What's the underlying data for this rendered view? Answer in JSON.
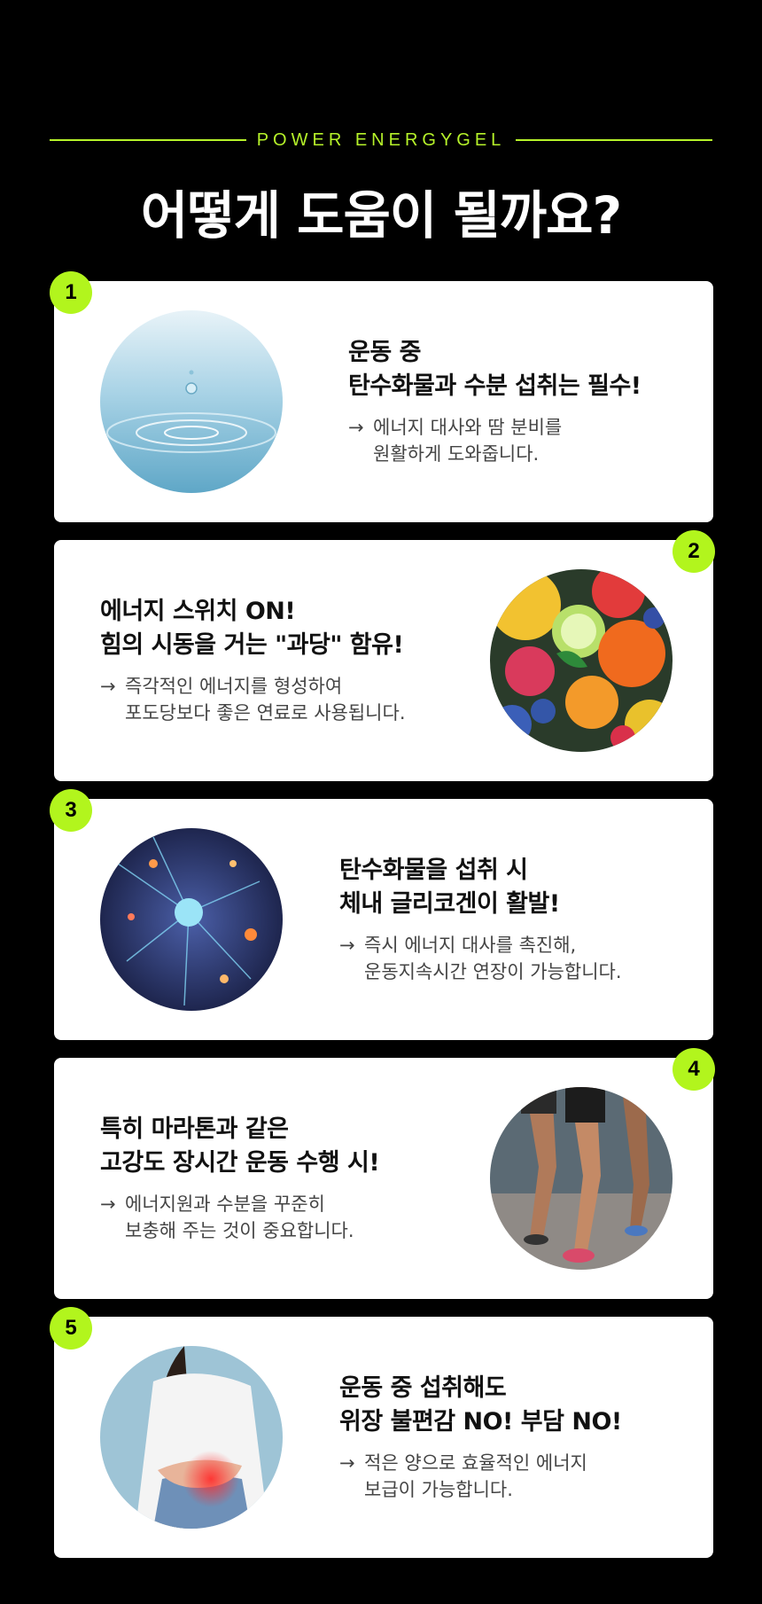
{
  "header": {
    "eyebrow": "POWER ENERGYGEL",
    "title": "어떻게 도움이 될까요?"
  },
  "arrow": "→",
  "cards": [
    {
      "number": "1",
      "image": "water-drop",
      "headline": [
        "운동 중",
        "탄수화물과 수분 섭취는 필수!"
      ],
      "desc": [
        "에너지 대사와 땀 분비를",
        "원활하게 도와줍니다."
      ]
    },
    {
      "number": "2",
      "image": "mixed-fruits",
      "headline": [
        "에너지 스위치 ON!",
        "힘의 시동을 거는 \"과당\" 함유!"
      ],
      "desc": [
        "즉각적인 에너지를 형성하여",
        "포도당보다 좋은 연료로 사용됩니다."
      ]
    },
    {
      "number": "3",
      "image": "neuron-network",
      "headline": [
        "탄수화물을 섭취 시",
        "체내 글리코겐이 활발!"
      ],
      "desc": [
        "즉시 에너지 대사를 촉진해,",
        "운동지속시간 연장이 가능합니다."
      ]
    },
    {
      "number": "4",
      "image": "marathon-runners",
      "headline": [
        "특히 마라톤과 같은",
        "고강도 장시간 운동 수행 시!"
      ],
      "desc": [
        "에너지원과 수분을 꾸준히",
        "보충해 주는 것이 중요합니다."
      ]
    },
    {
      "number": "5",
      "image": "stomach-discomfort",
      "headline": [
        "운동 중 섭취해도",
        "위장 불편감 NO! 부담 NO!"
      ],
      "desc": [
        "적은 양으로 효율적인 에너지",
        "보급이 가능합니다."
      ]
    }
  ],
  "colors": {
    "accent": "#b2f51d",
    "background": "#000000",
    "card": "#ffffff"
  }
}
